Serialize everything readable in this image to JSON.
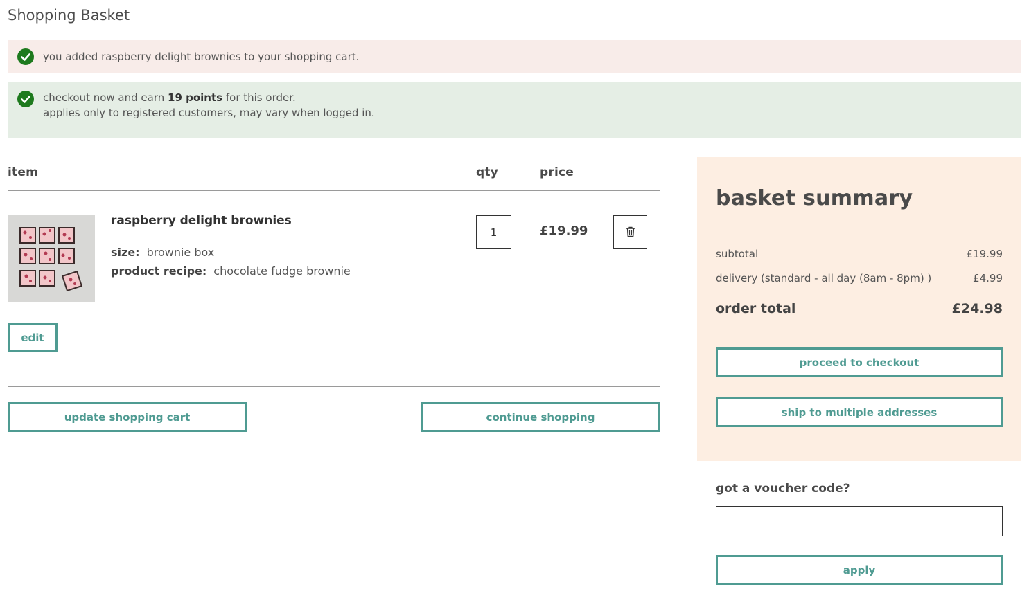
{
  "page": {
    "title": "Shopping Basket"
  },
  "messages": {
    "success": "you added raspberry delight brownies to your shopping cart.",
    "points_prefix": "checkout now and earn ",
    "points_value": "19 points",
    "points_suffix": " for this order.",
    "points_note": "applies only to registered customers, may vary when logged in."
  },
  "cart": {
    "headers": {
      "item": "item",
      "qty": "qty",
      "price": "price"
    },
    "item": {
      "name": "raspberry delight brownies",
      "size_label": "size:",
      "size_value": "brownie box",
      "recipe_label": "product recipe:",
      "recipe_value": "chocolate fudge brownie",
      "qty": "1",
      "price": "£19.99"
    },
    "edit_label": "edit",
    "update_label": "update shopping cart",
    "continue_label": "continue shopping"
  },
  "summary": {
    "title": "basket summary",
    "subtotal_label": "subtotal",
    "subtotal_value": "£19.99",
    "delivery_label": "delivery (standard - all day (8am - 8pm) )",
    "delivery_value": "£4.99",
    "total_label": "order total",
    "total_value": "£24.98",
    "checkout_label": "proceed to checkout",
    "multi_label": "ship to multiple addresses"
  },
  "voucher": {
    "label": "got a voucher code?",
    "value": "",
    "apply_label": "apply"
  },
  "icons": {
    "success": "check-circle-icon",
    "delete": "trash-icon"
  },
  "colors": {
    "accent": "#4f9b92",
    "success_bg": "#f8ece9",
    "points_bg": "#e5eee5",
    "summary_bg": "#fdeee2",
    "check": "#1e7a1e"
  }
}
